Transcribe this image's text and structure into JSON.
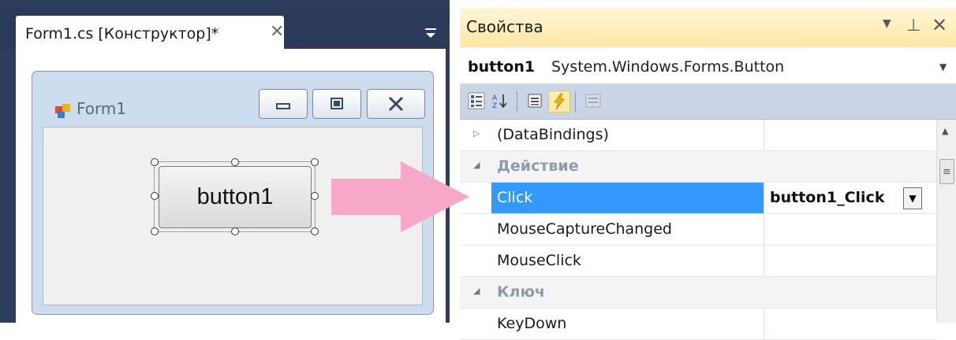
{
  "designer": {
    "tab_label": "Form1.cs [Конструктор]*",
    "close_glyph": "✕",
    "form": {
      "title": "Form1",
      "min_glyph": "▭",
      "max_glyph": "▢",
      "close_glyph": "✕",
      "button_label": "button1"
    }
  },
  "properties": {
    "title": "Свойства",
    "dropdown_glyph": "▼",
    "pin_glyph": "⊥",
    "close_glyph": "✕",
    "object_name": "button1",
    "object_type": "System.Windows.Forms.Button",
    "combo_glyph": "▼",
    "toolbar": {
      "categorized_glyph": "▤",
      "alphabetical_glyph": "A↓",
      "properties_glyph": "▥",
      "events_glyph": "⚡",
      "pages_glyph": "▦"
    },
    "rows": [
      {
        "name": "(DataBindings)",
        "glyph": "▷"
      },
      {
        "name": "Действие",
        "glyph": "◢"
      },
      {
        "name": "Click",
        "value": "button1_Click"
      },
      {
        "name": "MouseCaptureChanged"
      },
      {
        "name": "MouseClick"
      },
      {
        "name": "Ключ",
        "glyph": "◢"
      },
      {
        "name": "KeyDown"
      }
    ],
    "value_dropdown_glyph": "▼",
    "scroll_up_glyph": "▲",
    "scroll_thumb_glyph": "≡"
  },
  "colors": {
    "arrow": "#f7a8c8",
    "selection": "#3399ff",
    "header": "#ffe7a3"
  }
}
